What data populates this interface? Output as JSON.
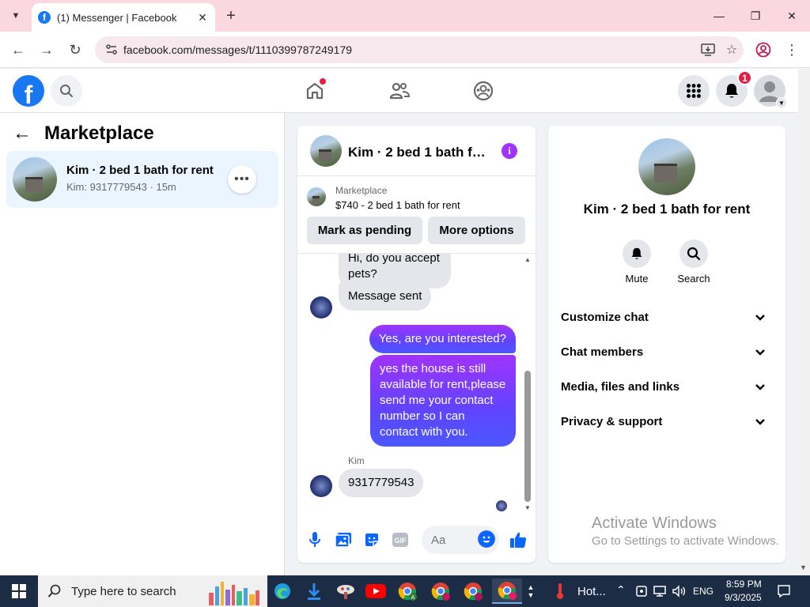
{
  "browser": {
    "tab_title": "(1) Messenger | Facebook",
    "url": "facebook.com/messages/t/1110399787249179"
  },
  "header": {
    "notification_count": "1"
  },
  "left_panel": {
    "title": "Marketplace",
    "conversation": {
      "name": "Kim · 2 bed 1 bath for rent",
      "subtitle": "Kim: 9317779543 · 15m"
    }
  },
  "chat": {
    "title": "Kim · 2 bed 1 bath fo...",
    "marketplace_label": "Marketplace",
    "listing": "$740 - 2 bed 1 bath for rent",
    "mark_pending_label": "Mark as pending",
    "more_options_label": "More options",
    "messages": {
      "m1": "Hi, do you accept pets?",
      "m2": "Message sent",
      "m3": "Yes, are you interested?",
      "m4": "yes the house is still available for rent,please send me your contact number so I can contact with you.",
      "sender": "Kim",
      "m5": "9317779543"
    },
    "composer_placeholder": "Aa"
  },
  "right_panel": {
    "title": "Kim · 2 bed 1 bath for rent",
    "mute_label": "Mute",
    "search_label": "Search",
    "sections": [
      "Customize chat",
      "Chat members",
      "Media, files and links",
      "Privacy & support"
    ]
  },
  "watermark": {
    "line1": "Activate Windows",
    "line2": "Go to Settings to activate Windows."
  },
  "taskbar": {
    "search_placeholder": "Type here to search",
    "weather": "Hot...",
    "language": "ENG",
    "time": "8:59 PM",
    "date": "9/3/2025"
  },
  "colors": {
    "facebook_blue": "#1877f2",
    "messenger_purple": "#a033ff",
    "badge_red": "#e41e3f",
    "tab_bar_pink": "#fbd7e0"
  }
}
